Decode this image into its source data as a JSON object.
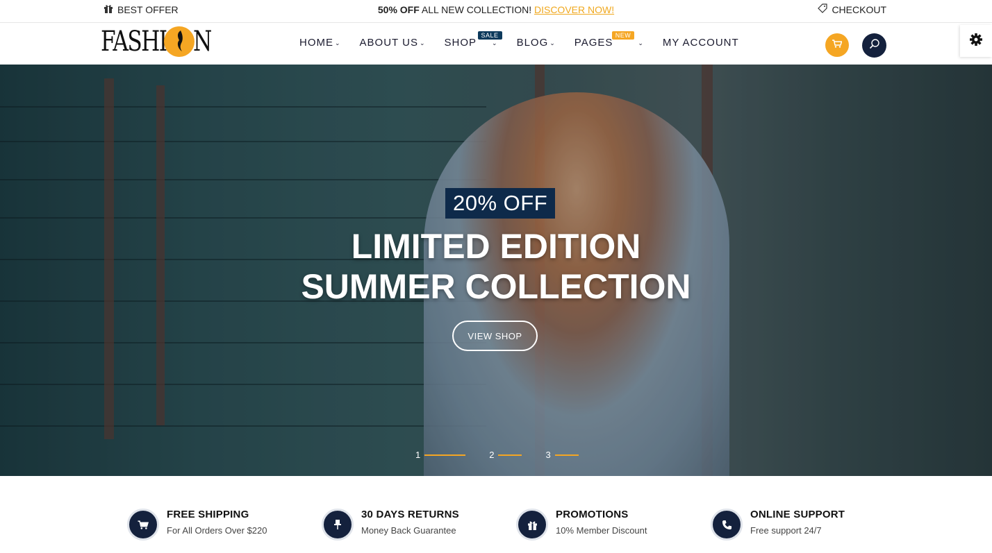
{
  "topbar": {
    "best_offer": "BEST OFFER",
    "promo_bold": "50% OFF",
    "promo_text": "ALL NEW COLLECTION!",
    "promo_link": "DISCOVER NOW!",
    "checkout": "CHECKOUT"
  },
  "header": {
    "logo_text": "FASHI",
    "logo_text_end": "N",
    "nav": {
      "home": "HOME",
      "about": "ABOUT US",
      "shop": "SHOP",
      "shop_badge": "SALE",
      "blog": "BLOG",
      "pages": "PAGES",
      "pages_badge": "NEW",
      "account": "MY ACCOUNT"
    },
    "icons": {
      "cart": "cart-icon",
      "search": "search-icon",
      "settings": "gear-icon"
    }
  },
  "hero": {
    "discount": "20% OFF",
    "headline_line1": "LIMITED EDITION",
    "headline_line2": "SUMMER COLLECTION",
    "button": "VIEW SHOP",
    "slides": [
      "1",
      "2",
      "3"
    ]
  },
  "features": [
    {
      "icon": "cart-icon",
      "title": "FREE SHIPPING",
      "subtitle": "For All Orders Over $220"
    },
    {
      "icon": "pin-icon",
      "title": "30 DAYS RETURNS",
      "subtitle": "Money Back Guarantee"
    },
    {
      "icon": "gift-icon",
      "title": "PROMOTIONS",
      "subtitle": "10% Member Discount"
    },
    {
      "icon": "phone-icon",
      "title": "ONLINE SUPPORT",
      "subtitle": "Free support 24/7"
    }
  ],
  "colors": {
    "accent": "#f5a623",
    "navy": "#14213d",
    "badge_sale": "#0d3a5c"
  }
}
